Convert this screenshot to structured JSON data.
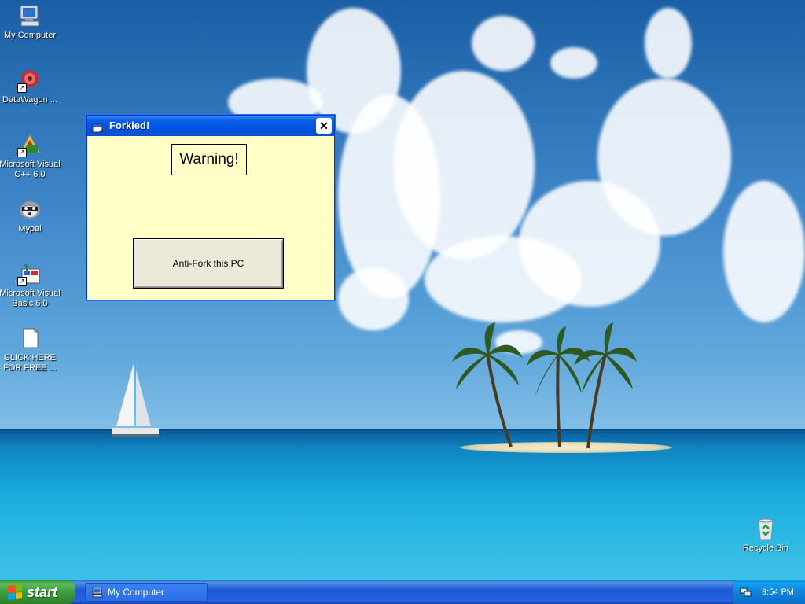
{
  "desktop": {
    "icons": [
      {
        "label": "My Computer",
        "icon": "my-computer-icon"
      },
      {
        "label": "DataWagon ...",
        "icon": "datawagon-icon"
      },
      {
        "label": "Microsoft Visual C++ 6.0",
        "icon": "visual-cpp-icon"
      },
      {
        "label": "Mypal",
        "icon": "mypal-browser-icon"
      },
      {
        "label": "Microsoft Visual Basic 6.0",
        "icon": "visual-basic-icon"
      },
      {
        "label": "CLICK HERE FOR FREE ...",
        "icon": "document-icon"
      },
      {
        "label": "Recycle Bin",
        "icon": "recycle-bin-icon"
      }
    ]
  },
  "window": {
    "title": "Forkied!",
    "warning_text": "Warning!",
    "button_label": "Anti-Fork this PC",
    "close_glyph": "✕",
    "background_color": "#ffffc6"
  },
  "taskbar": {
    "start_label": "start",
    "tasks": [
      {
        "label": "My Computer",
        "icon": "my-computer-icon"
      }
    ],
    "clock": "9:54 PM"
  },
  "colors": {
    "titlebar": "#0054e3",
    "taskbar": "#2157d7",
    "start_button": "#3a9a3a"
  }
}
